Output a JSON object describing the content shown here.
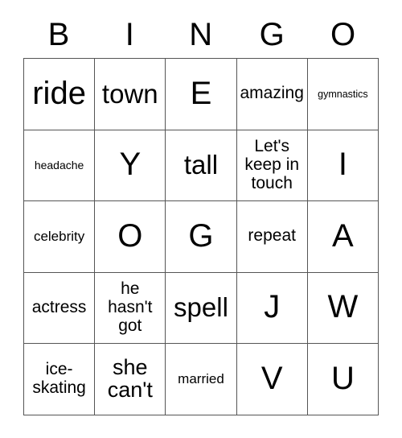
{
  "card": {
    "title": "BINGO",
    "header_letters": [
      "B",
      "I",
      "N",
      "G",
      "O"
    ],
    "grid_line_color": "#555555",
    "background_color": "#ffffff",
    "text_color": "#000000",
    "columns": 5,
    "rows": 5,
    "cells": [
      [
        {
          "text": "ride",
          "size": "xxl"
        },
        {
          "text": "town",
          "size": "xl"
        },
        {
          "text": "E",
          "size": "xxl"
        },
        {
          "text": "amazing",
          "size": "md"
        },
        {
          "text": "gymnastics",
          "size": "xxs"
        }
      ],
      [
        {
          "text": "headache",
          "size": "xs"
        },
        {
          "text": "Y",
          "size": "xxl"
        },
        {
          "text": "tall",
          "size": "xl"
        },
        {
          "text": "Let's\nkeep in\ntouch",
          "size": "md"
        },
        {
          "text": "I",
          "size": "xxl"
        }
      ],
      [
        {
          "text": "celebrity",
          "size": "sm"
        },
        {
          "text": "O",
          "size": "xxl"
        },
        {
          "text": "G",
          "size": "xxl"
        },
        {
          "text": "repeat",
          "size": "md"
        },
        {
          "text": "A",
          "size": "xxl"
        }
      ],
      [
        {
          "text": "actress",
          "size": "md"
        },
        {
          "text": "he\nhasn't\ngot",
          "size": "md"
        },
        {
          "text": "spell",
          "size": "xl"
        },
        {
          "text": "J",
          "size": "xxl"
        },
        {
          "text": "W",
          "size": "xxl"
        }
      ],
      [
        {
          "text": "ice-\nskating",
          "size": "md"
        },
        {
          "text": "she\ncan't",
          "size": "lg"
        },
        {
          "text": "married",
          "size": "sm"
        },
        {
          "text": "V",
          "size": "xxl"
        },
        {
          "text": "U",
          "size": "xxl"
        }
      ]
    ]
  }
}
